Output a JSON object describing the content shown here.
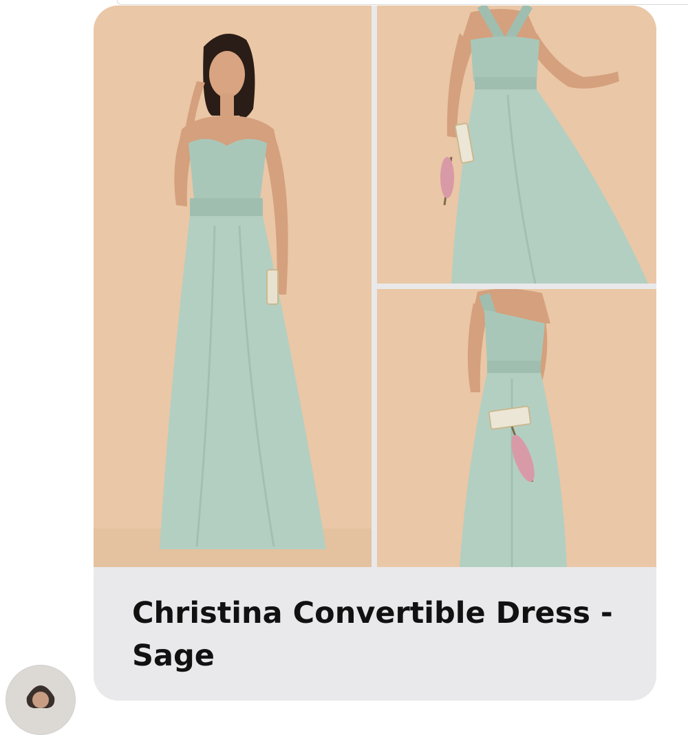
{
  "message": {
    "product_title": "Christina Convertible Dress - Sage",
    "images": [
      {
        "label": "strapless style"
      },
      {
        "label": "halter style"
      },
      {
        "label": "one-shoulder style"
      }
    ]
  },
  "colors": {
    "background_beige": "#eac7a6",
    "dress_sage": "#a9c7b9",
    "caption_gray": "#e9e9eb"
  }
}
